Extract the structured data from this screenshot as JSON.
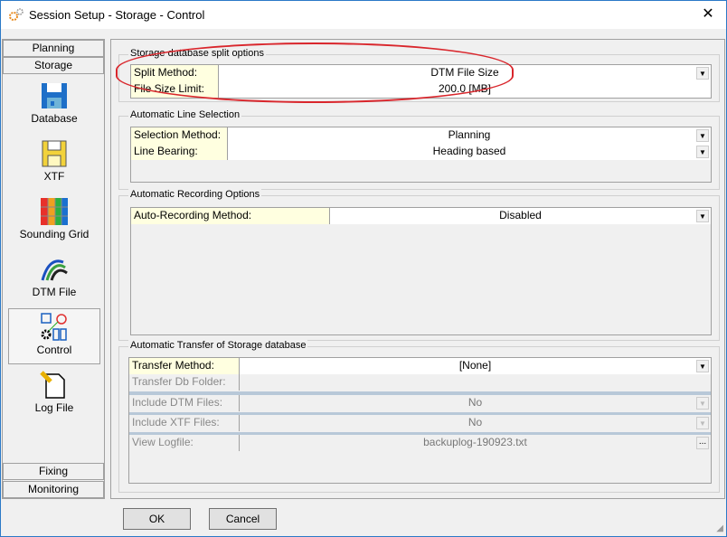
{
  "window": {
    "title": "Session Setup - Storage -  Control",
    "close": "✕"
  },
  "sidebar": {
    "tabs_top": [
      "Planning",
      "Storage"
    ],
    "items": [
      {
        "label": "Database",
        "icon": "floppy-disk-icon"
      },
      {
        "label": "XTF",
        "icon": "floppy-yellow-icon"
      },
      {
        "label": "Sounding Grid",
        "icon": "color-grid-icon"
      },
      {
        "label": "DTM File",
        "icon": "dtm-wave-icon"
      },
      {
        "label": "Control",
        "icon": "control-gear-icon",
        "selected": true
      },
      {
        "label": "Log File",
        "icon": "log-file-icon"
      }
    ],
    "tabs_bottom": [
      "Fixing",
      "Monitoring"
    ]
  },
  "groups": {
    "split": {
      "title": "Storage database split options",
      "rows": [
        {
          "label": "Split Method:",
          "value": "DTM File Size"
        },
        {
          "label": "File Size Limit:",
          "value": "200.0 [MB]"
        }
      ]
    },
    "line": {
      "title": "Automatic Line Selection",
      "rows": [
        {
          "label": "Selection Method:",
          "value": "Planning"
        },
        {
          "label": "Line Bearing:",
          "value": "Heading based"
        }
      ]
    },
    "recording": {
      "title": "Automatic Recording Options",
      "rows": [
        {
          "label": "Auto-Recording Method:",
          "value": "Disabled"
        }
      ]
    },
    "transfer": {
      "title": "Automatic Transfer of Storage database",
      "rows": [
        {
          "label": "Transfer Method:",
          "value": "[None]"
        },
        {
          "label": "Transfer Db Folder:",
          "value": ""
        },
        {
          "label": "Include DTM Files:",
          "value": "No"
        },
        {
          "label": "Include XTF Files:",
          "value": "No"
        },
        {
          "label": "View Logfile:",
          "value": "backuplog-190923.txt"
        }
      ],
      "browse": "..."
    }
  },
  "buttons": {
    "ok": "OK",
    "cancel": "Cancel"
  },
  "colors": {
    "highlight": "#d9262c",
    "label_bg": "#ffffe0"
  }
}
